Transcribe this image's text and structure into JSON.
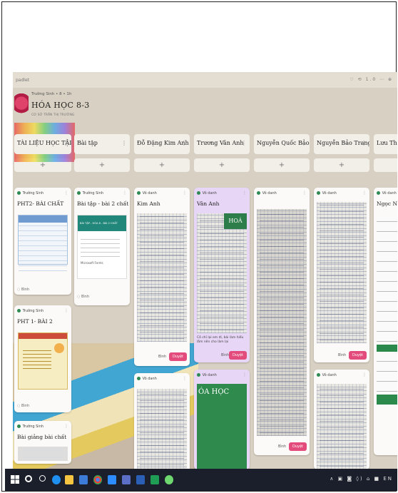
{
  "app": {
    "name": "padlet",
    "topbar_icons": "♡ ⟲ 1.0 ⋯ ⊕"
  },
  "board": {
    "author": "Trường Sinh • 8 • 1h",
    "title": "HÓA HỌC 8-3",
    "subtitle": "CƠ SỞ TRẦN THỊ TRƯỜNG"
  },
  "columns": [
    {
      "title": "TÀI LIỆU HỌC TẬP",
      "cards": [
        {
          "author": "Trường Sinh",
          "title": "PHT2- BÀI CHẤT",
          "footer": "Bình"
        },
        {
          "author": "Trường Sinh",
          "title": "PHT 1- BÀI 2",
          "footer": "Bình"
        },
        {
          "author": "Trường Sinh",
          "title": "Bài giảng bài chất"
        }
      ]
    },
    {
      "title": "Bài tập",
      "cards": [
        {
          "author": "Trường Sinh",
          "title": "Bài tập - bài 2 chất",
          "form_header": "BÀI TẬP - HÓA 8 - BÀI 2 CHẤT",
          "form_link": "Microsoft Forms",
          "footer": "Bình"
        }
      ]
    },
    {
      "title": "Đỗ Đặng Kim Anh",
      "cards": [
        {
          "author": "Vô danh",
          "title": "Kim Anh",
          "link": "Bình",
          "button": "Duyệt"
        },
        {
          "author": "Vô danh"
        }
      ]
    },
    {
      "title": "Trương Vân Anh",
      "cards": [
        {
          "author": "Vô danh",
          "title": "Vân Anh",
          "photo_label": "HOÁ",
          "caption": "Cô chỉ lại em đi, bài làm hiểu lắm nên cho làm lại",
          "link": "Bình",
          "button": "Duyệt"
        },
        {
          "author": "Vô danh",
          "photo_label": "ÓA HỌC"
        }
      ]
    },
    {
      "title": "Nguyễn Quốc Bảo",
      "cards": [
        {
          "author": "Vô danh",
          "link": "Bình",
          "button": "Duyệt"
        }
      ]
    },
    {
      "title": "Nguyễn Bảo Trang",
      "cards": [
        {
          "author": "Vô danh",
          "link": "Bình",
          "button": "Duyệt"
        },
        {
          "author": "Vô danh"
        }
      ]
    },
    {
      "title": "Lưu Thị Ngọc Ngà",
      "cards": [
        {
          "author": "Vô danh",
          "title": "Ngọc Ngà"
        }
      ]
    }
  ],
  "add_label": "+",
  "taskbar": {
    "tray": "∧ ▣ ◙ ◊) ⌂ ■ EN"
  }
}
